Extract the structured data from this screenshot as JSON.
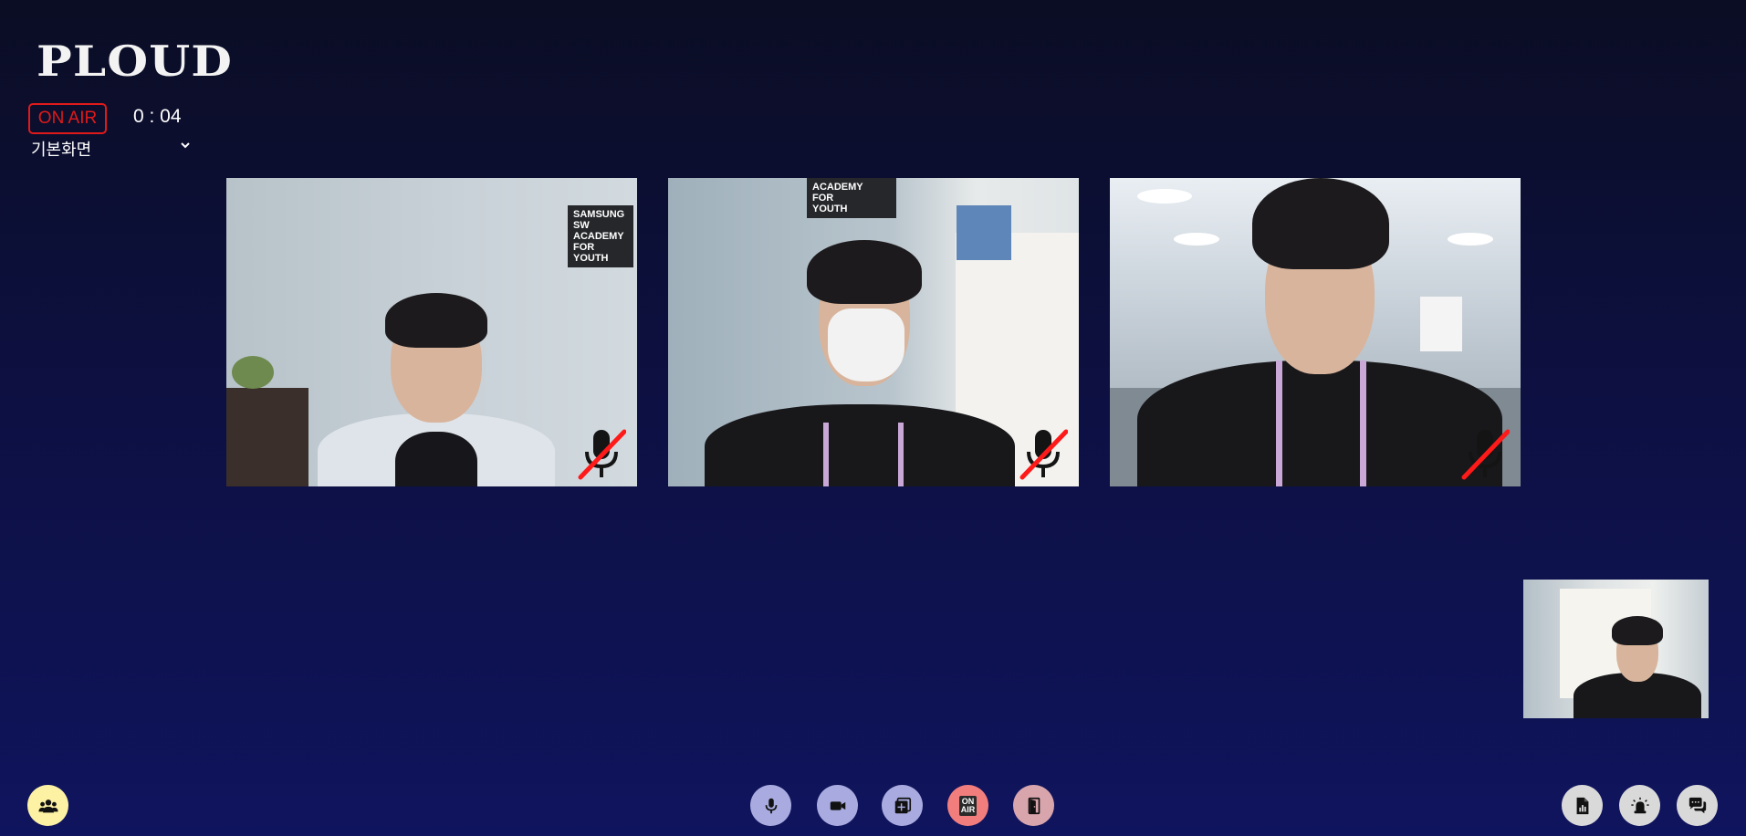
{
  "app": {
    "logo_text": "PLOUD"
  },
  "status": {
    "onair_label": "ON AIR",
    "timer": "0 : 04",
    "onair_color": "#e01a1a"
  },
  "layout_select": {
    "selected": "기본화면",
    "icon": "chevron-down-icon"
  },
  "video_tiles": [
    {
      "banner_lines": [
        "SAMSUNG",
        "SW",
        "ACADEMY",
        "FOR",
        "YOUTH"
      ],
      "mic_muted": true
    },
    {
      "banner_lines": [
        "ACADEMY",
        "FOR",
        "YOUTH"
      ],
      "mic_muted": true
    },
    {
      "banner_lines": [],
      "mic_muted": true
    }
  ],
  "toolbar": {
    "left": [
      {
        "name": "participants-button",
        "icon": "people-icon",
        "color": "#fdf1a4"
      }
    ],
    "center": [
      {
        "name": "mic-button",
        "icon": "microphone-icon",
        "color": "#a9abe0"
      },
      {
        "name": "camera-button",
        "icon": "video-camera-icon",
        "color": "#a9abe0"
      },
      {
        "name": "share-button",
        "icon": "add-square-icon",
        "color": "#a9abe0"
      },
      {
        "name": "onair-button",
        "icon": "on-air-icon",
        "color": "#f27d7d",
        "label_line1": "ON",
        "label_line2": "AIR"
      },
      {
        "name": "exit-button",
        "icon": "door-exit-icon",
        "color": "#d8a5ad"
      }
    ],
    "right": [
      {
        "name": "report-button",
        "icon": "document-chart-icon",
        "color": "#d9d9d9"
      },
      {
        "name": "alarm-button",
        "icon": "siren-icon",
        "color": "#d9d9d9"
      },
      {
        "name": "chat-button",
        "icon": "chat-bubbles-icon",
        "color": "#d9d9d9"
      }
    ]
  }
}
